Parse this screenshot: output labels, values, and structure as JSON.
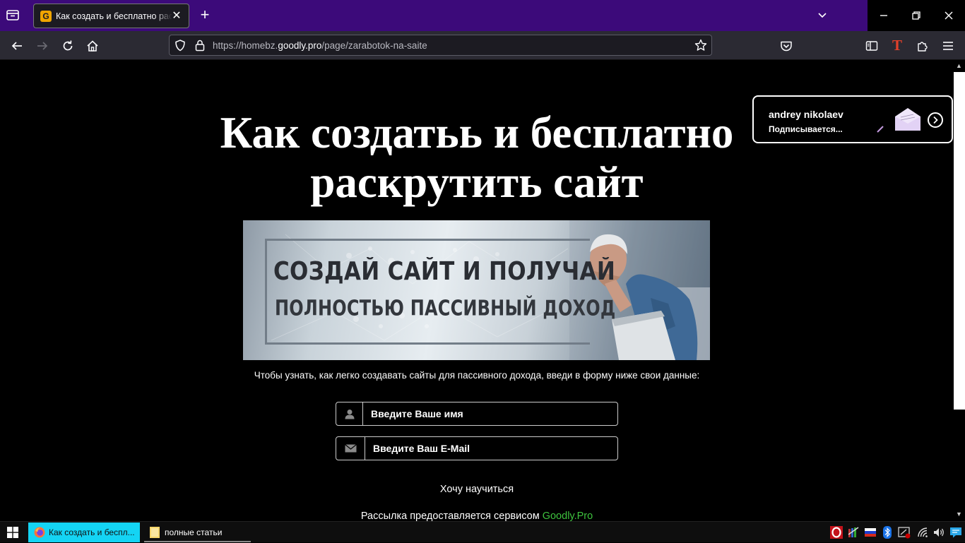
{
  "browser": {
    "tab": {
      "title": "Как создать и бесплатно раскрутить сайт",
      "favicon_letter": "G"
    },
    "new_tab_label": "+",
    "url": {
      "scheme_sub": "https://homebz.",
      "domain": "goodly.pro",
      "path": "/page/zarabotok-na-saite"
    },
    "extension_letter": "T",
    "colors": {
      "tab_strip": "#3c0a7a",
      "nav_bar": "#2b2a33",
      "url_field": "#1c1b22"
    }
  },
  "page": {
    "headline": "Как создатьь и бесплатно раскрутить сайт",
    "banner": {
      "line1": "СОЗДАЙ САЙТ И ПОЛУЧАЙ",
      "line2": "ПОЛНОСТЬЮ ПАССИВНЫЙ ДОХОД"
    },
    "intro": "Чтобы узнать, как легко создавать сайты для пассивного дохода, введи в форму ниже свои данные:",
    "form": {
      "name_placeholder": "Введите Ваше имя",
      "email_placeholder": "Введите Ваш E-Mail",
      "submit_label": "Хочу научиться"
    },
    "footer": {
      "text": "Рассылка предоставляется сервисом ",
      "link": "Goodly.Pro",
      "link_color": "#3ec23e"
    },
    "notification": {
      "name": "andrey nikolaev",
      "status": "Подписывается..."
    }
  },
  "taskbar": {
    "apps": [
      {
        "label": "Как создать и беспл...",
        "active": true,
        "icon": "firefox-icon"
      },
      {
        "label": "полные статьи",
        "active": false,
        "icon": "folder-icon"
      }
    ],
    "accent": "#14d4f4"
  }
}
